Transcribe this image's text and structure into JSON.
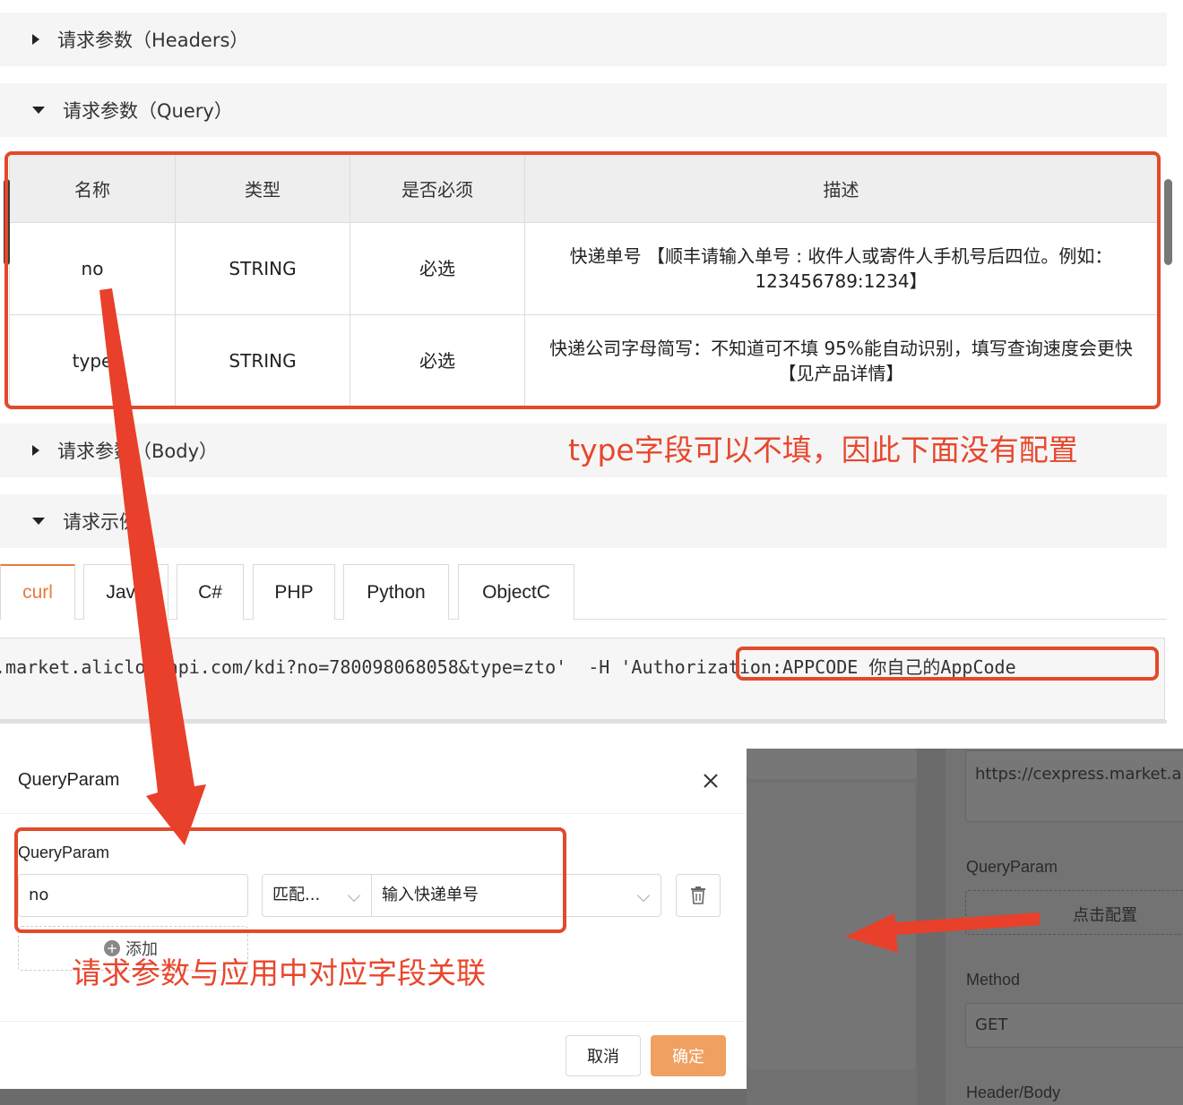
{
  "sections": {
    "headers": "请求参数（Headers）",
    "query": "请求参数（Query）",
    "body": "请求参数（Body）",
    "example": "请求示例"
  },
  "table": {
    "headers": [
      "名称",
      "类型",
      "是否必须",
      "描述"
    ],
    "rows": [
      {
        "name": "no",
        "type": "STRING",
        "required": "必选",
        "desc": "快递单号 【顺丰请输入单号 : 收件人或寄件人手机号后四位。例如：123456789:1234】"
      },
      {
        "name": "type",
        "type": "STRING",
        "required": "必选",
        "desc": "快递公司字母简写：不知道可不填 95%能自动识别，填写查询速度会更快【见产品详情】"
      }
    ]
  },
  "tabs": [
    "curl",
    "Java",
    "C#",
    "PHP",
    "Python",
    "ObjectC"
  ],
  "code": {
    "line": ".market.alicloudapi.com/kdi?no=780098068058&type=zto'  -H 'Authorization:APPCODE 你自己的AppCode"
  },
  "modal": {
    "title": "QueryParam",
    "field_label": "QueryParam",
    "name_value": "no",
    "match_value": "匹配...",
    "mapping_value": "输入快递单号",
    "add_label": "添加",
    "cancel_label": "取消",
    "ok_label": "确定"
  },
  "side_panel": {
    "url": "https://cexpress.market.alicloudapi.com/cexpress",
    "queryparam_label": "QueryParam",
    "config_label": "点击配置",
    "method_label": "Method",
    "method_value": "GET",
    "headerbody_label": "Header/Body"
  },
  "annotations": {
    "type_note": "type字段可以不填，因此下面没有配置",
    "link_note": "请求参数与应用中对应字段关联"
  },
  "colors": {
    "accent": "#e67c3f",
    "annotation_red": "#e14a2c",
    "ok_button": "#f0a060"
  }
}
